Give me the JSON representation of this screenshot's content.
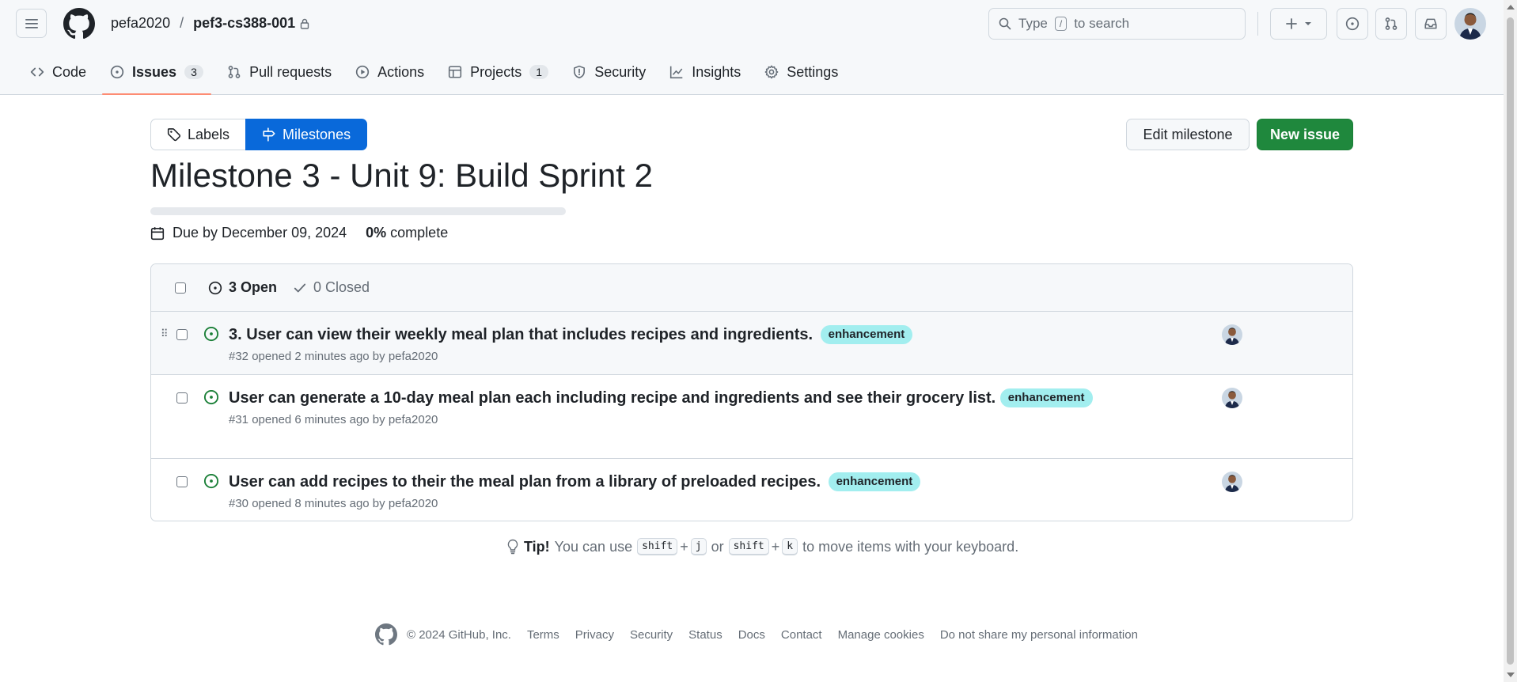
{
  "header": {
    "owner": "pefa2020",
    "separator": "/",
    "repo": "pef3-cs388-001",
    "search_prefix": "Type",
    "search_key": "/",
    "search_suffix": "to search"
  },
  "tabs": [
    {
      "label": "Code",
      "icon": "code-icon"
    },
    {
      "label": "Issues",
      "icon": "issue-opened-icon",
      "count": "3",
      "active": true
    },
    {
      "label": "Pull requests",
      "icon": "git-pull-request-icon"
    },
    {
      "label": "Actions",
      "icon": "play-icon"
    },
    {
      "label": "Projects",
      "icon": "table-icon",
      "count": "1"
    },
    {
      "label": "Security",
      "icon": "shield-icon"
    },
    {
      "label": "Insights",
      "icon": "graph-icon"
    },
    {
      "label": "Settings",
      "icon": "gear-icon"
    }
  ],
  "subnav": {
    "labels": "Labels",
    "milestones": "Milestones"
  },
  "actions": {
    "edit_milestone": "Edit milestone",
    "new_issue": "New issue"
  },
  "milestone": {
    "title": "Milestone 3 - Unit 9: Build Sprint 2",
    "due": "Due by December 09, 2024",
    "percent": "0%",
    "percent_suffix": "complete",
    "progress_fraction": 0
  },
  "issue_list": {
    "open": "3 Open",
    "closed": "0 Closed",
    "issues": [
      {
        "title": "3. User can view their weekly meal plan that includes recipes and ingredients.",
        "label": "enhancement",
        "meta": "#32 opened 2 minutes ago by pefa2020"
      },
      {
        "title": "User can generate a 10-day meal plan each including recipe and ingredients and see their grocery list.",
        "label": "enhancement",
        "meta": "#31 opened 6 minutes ago by pefa2020"
      },
      {
        "title": "User can add recipes to their the meal plan from a library of preloaded recipes.",
        "label": "enhancement",
        "meta": "#30 opened 8 minutes ago by pefa2020"
      }
    ]
  },
  "tip": {
    "lead": "Tip!",
    "text1": "You can use",
    "key_shift": "shift",
    "plus": "+",
    "key_j": "j",
    "or": "or",
    "key_shift2": "shift",
    "key_k": "k",
    "text2": "to move items with your keyboard."
  },
  "footer": {
    "copyright": "© 2024 GitHub, Inc.",
    "links": [
      "Terms",
      "Privacy",
      "Security",
      "Status",
      "Docs",
      "Contact",
      "Manage cookies",
      "Do not share my personal information"
    ]
  },
  "colors": {
    "accent_blue": "#0969da",
    "primary_green": "#1f883d",
    "label_bg": "#a2eeef",
    "tab_underline": "#fd8c73"
  }
}
